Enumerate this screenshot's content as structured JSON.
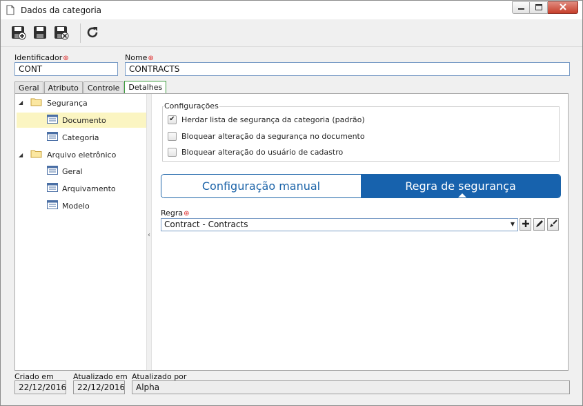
{
  "window": {
    "title": "Dados da categoria",
    "icons": [
      "document-icon",
      "minimize-icon",
      "maximize-icon",
      "close-icon"
    ]
  },
  "toolbar": {
    "buttons": [
      {
        "name": "save-new-button",
        "icon": "save-plus-icon"
      },
      {
        "name": "save-button",
        "icon": "save-icon"
      },
      {
        "name": "save-close-button",
        "icon": "save-close-icon"
      },
      {
        "name": "refresh-button",
        "icon": "refresh-icon"
      }
    ]
  },
  "form": {
    "identificador_label": "Identificador",
    "identificador_value": "CONT",
    "nome_label": "Nome",
    "nome_value": "CONTRACTS",
    "required_mark": "⊛"
  },
  "tabs": [
    {
      "label": "Geral"
    },
    {
      "label": "Atributo"
    },
    {
      "label": "Controle"
    },
    {
      "label": "Detalhes",
      "active": true
    }
  ],
  "tree": {
    "nodes": [
      {
        "label": "Segurança",
        "type": "folder",
        "expanded": true
      },
      {
        "label": "Documento",
        "type": "item",
        "selected": true
      },
      {
        "label": "Categoria",
        "type": "item"
      },
      {
        "label": "Arquivo eletrônico",
        "type": "folder",
        "expanded": true
      },
      {
        "label": "Geral",
        "type": "item"
      },
      {
        "label": "Arquivamento",
        "type": "item"
      },
      {
        "label": "Modelo",
        "type": "item"
      }
    ]
  },
  "configuracoes": {
    "title": "Configurações",
    "options": [
      {
        "label": "Herdar lista de segurança da categoria (padrão)",
        "checked": true
      },
      {
        "label": "Bloquear alteração da segurança no documento",
        "checked": false
      },
      {
        "label": "Bloquear alteração do usuário de cadastro",
        "checked": false
      }
    ]
  },
  "mode": {
    "manual_label": "Configuração manual",
    "rule_label": "Regra de segurança",
    "selected": "rule"
  },
  "regra": {
    "label": "Regra",
    "value": "Contract - Contracts",
    "buttons": [
      "add-icon",
      "edit-icon",
      "clear-icon"
    ]
  },
  "footer": {
    "criado_em_label": "Criado em",
    "criado_em_value": "22/12/2016",
    "atualizado_em_label": "Atualizado em",
    "atualizado_em_value": "22/12/2016",
    "atualizado_por_label": "Atualizado por",
    "atualizado_por_value": "Alpha"
  },
  "colors": {
    "accent": "#1762ad",
    "selected_row": "#fbf5c2",
    "required": "#dd2222",
    "close_button": "#c7402c"
  }
}
